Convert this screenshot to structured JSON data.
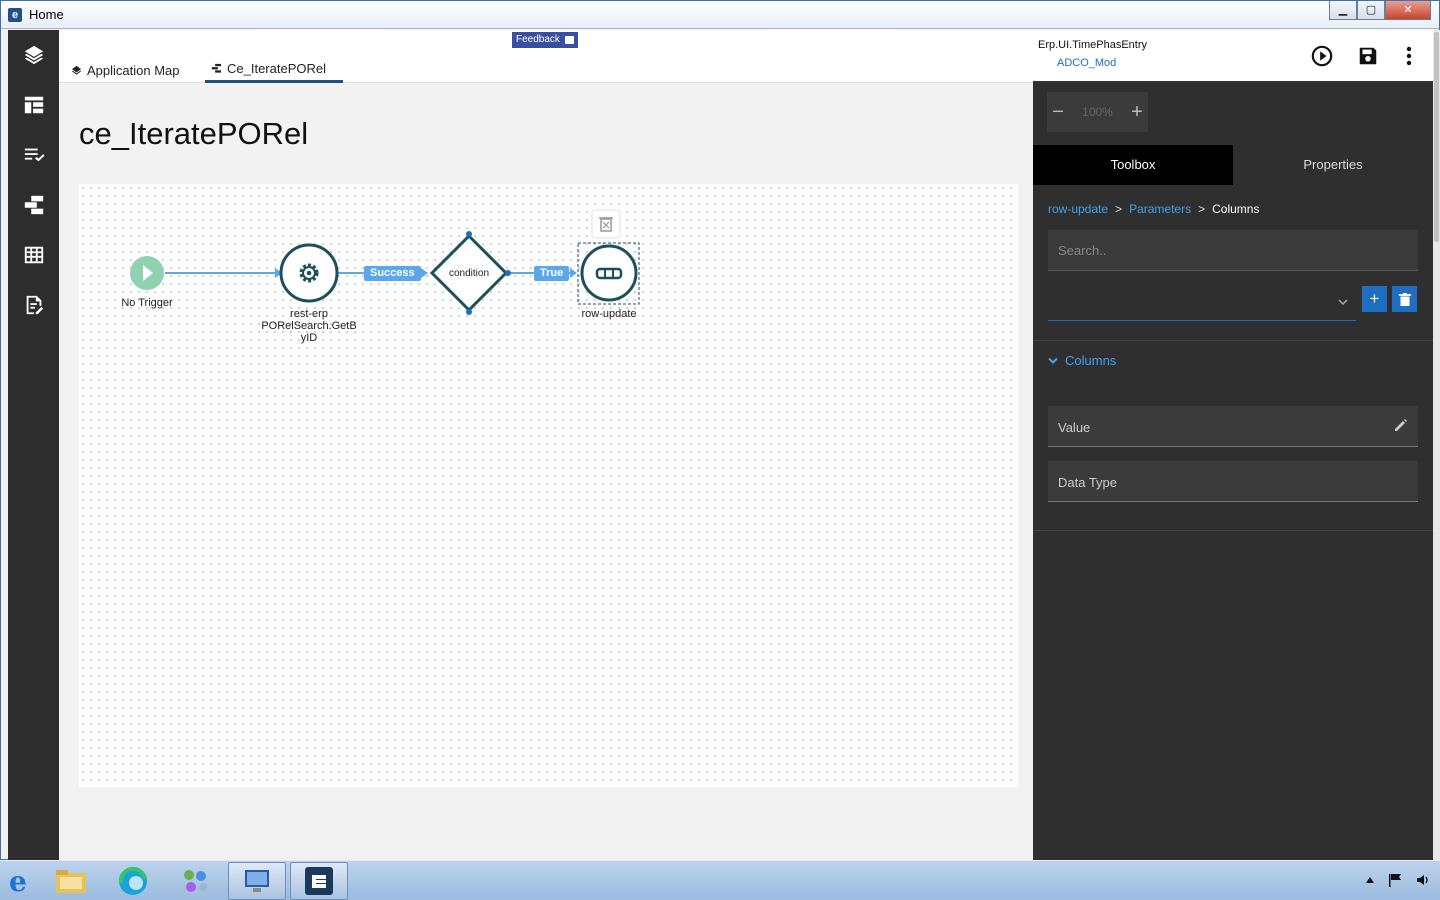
{
  "window": {
    "title": "Home"
  },
  "sidebar": {
    "items": [
      "layers-icon",
      "dashboard-icon",
      "tasks-icon",
      "flow-icon",
      "table-icon",
      "form-edit-icon"
    ]
  },
  "tabs": {
    "app_map": "Application Map",
    "current": "Ce_IteratePORel"
  },
  "feedback_label": "Feedback",
  "page_title": "ce_IteratePORel",
  "flow": {
    "trigger_label": "No Trigger",
    "rest_label_1": "rest-erp",
    "rest_label_2": "PORelSearch.GetB",
    "rest_label_3": "yID",
    "edge_success": "Success",
    "condition_label": "condition",
    "edge_true": "True",
    "row_update_label": "row-update"
  },
  "panel": {
    "name": "Erp.UI.TimePhasEntry",
    "module": "ADCO_Mod",
    "zoom_minus": "−",
    "zoom_value": "100%",
    "zoom_plus": "+",
    "tab_toolbox": "Toolbox",
    "tab_properties": "Properties",
    "crumb_1": "row-update",
    "crumb_2": "Parameters",
    "crumb_3": "Columns",
    "crumb_sep": ">",
    "search_placeholder": "Search..",
    "add_label": "+",
    "section_columns": "Columns",
    "field_value": "Value",
    "field_datatype": "Data Type"
  },
  "colors": {
    "accent": "#1e6fc1",
    "node_stroke": "#1d4f5c",
    "edge": "#5aa7ea",
    "trigger": "#8fd1b0"
  }
}
